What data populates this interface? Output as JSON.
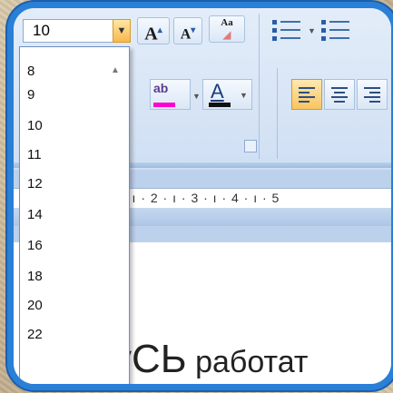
{
  "font_size_box": {
    "value": "10",
    "arrow_icon": "chevron-down-icon"
  },
  "toolbar": {
    "grow_font_label": "A",
    "shrink_font_label": "A",
    "clear_format_label": "Aa",
    "highlight_label": "ab",
    "font_color_label": "A",
    "highlight_color": "#ff00d2",
    "font_color": "#111111"
  },
  "font_sizes": [
    "8",
    "9",
    "10",
    "11",
    "12",
    "14",
    "16",
    "18",
    "20",
    "22"
  ],
  "ruler": {
    "marks": "· ı · 2 · ı · 3 · ı · 4 · ı · 5"
  },
  "document": {
    "text_big": "уСЬ",
    "text_rest": " работат"
  },
  "colors": {
    "frame_border": "#2a7fd6",
    "ribbon": "#dde8f6",
    "active_button": "#f8c562"
  }
}
